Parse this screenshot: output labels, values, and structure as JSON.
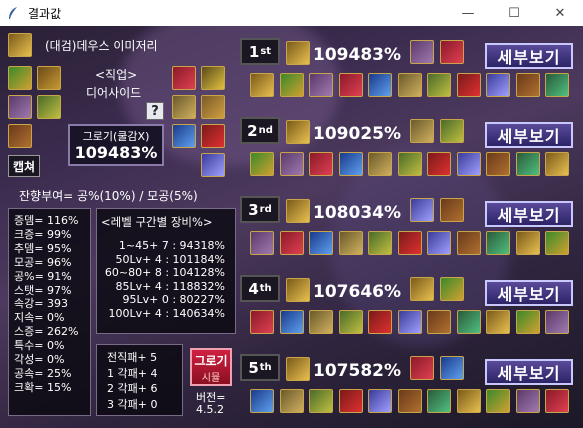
{
  "window": {
    "title": "결과값",
    "min": "—",
    "max": "☐",
    "close": "✕"
  },
  "character": {
    "name": "(대검)데우스 이미저리",
    "job_header": "<직업>",
    "job_name": "디어사이드",
    "help": "?"
  },
  "capture_label": "캡쳐",
  "grogi": {
    "label": "그로기(쿨감X)",
    "value": "109483%"
  },
  "buff": "잔향부여= 공%(10%) / 모공(5%)",
  "stats": [
    "증뎀= 116%",
    "크증= 99%",
    "추뎀= 95%",
    "모공= 96%",
    "공%= 91%",
    "스탯= 97%",
    "속강= 393",
    "지속= 0%",
    "스증= 262%",
    "특수= 0%",
    "각성= 0%",
    "공속= 25%",
    "크확= 15%"
  ],
  "levels": {
    "header": "<레벨 구간별 장비%>",
    "rows": [
      "1~45+ 7 : 94318%",
      "50Lv+ 4 : 101184%",
      "60~80+ 8 : 104128%",
      "85Lv+ 4 : 118832%",
      "95Lv+ 0 : 80227%",
      "100Lv+ 4 : 140634%"
    ]
  },
  "awaken": [
    "전직패+ 5",
    "1 각패+ 4",
    "2 각패+ 6",
    "3 각패+ 0"
  ],
  "grogi_button": {
    "top": "그로기",
    "bottom": "시뮬"
  },
  "version": {
    "label": "버전=",
    "value": "4.5.2"
  },
  "results": [
    {
      "rank": "1",
      "suffix": "st",
      "pct": "109483%",
      "btn": "세부보기"
    },
    {
      "rank": "2",
      "suffix": "nd",
      "pct": "109025%",
      "btn": "세부보기"
    },
    {
      "rank": "3",
      "suffix": "rd",
      "pct": "108034%",
      "btn": "세부보기"
    },
    {
      "rank": "4",
      "suffix": "th",
      "pct": "107646%",
      "btn": "세부보기"
    },
    {
      "rank": "5",
      "suffix": "th",
      "pct": "107582%",
      "btn": "세부보기"
    }
  ],
  "colors": {
    "gold_border": "#c9a54a",
    "panel_bg": "#0a0810",
    "detail_btn": "#4a3c88",
    "grogi_btn": "#c0203a"
  }
}
